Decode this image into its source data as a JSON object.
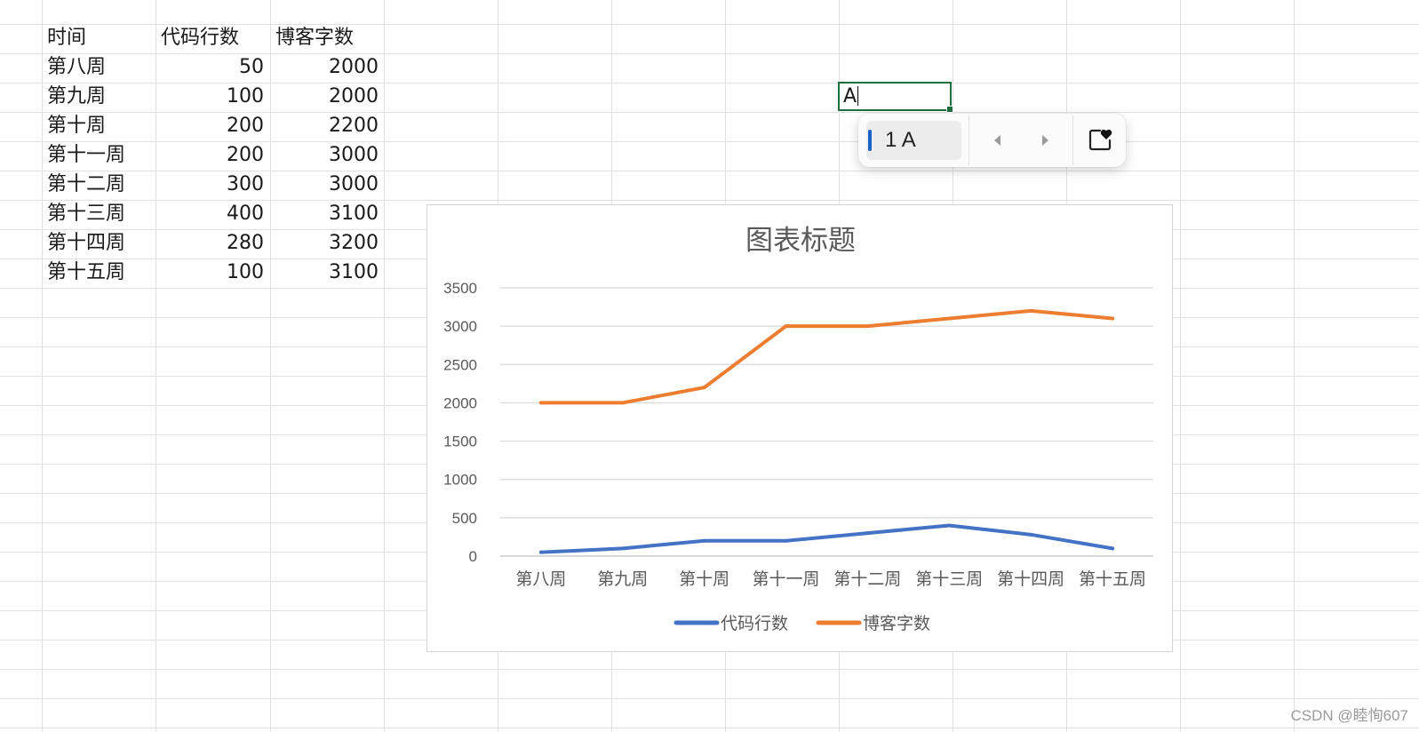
{
  "sheet": {
    "headers": [
      "时间",
      "代码行数",
      "博客字数"
    ],
    "rows": [
      [
        "第八周",
        "50",
        "2000"
      ],
      [
        "第九周",
        "100",
        "2000"
      ],
      [
        "第十周",
        "200",
        "2200"
      ],
      [
        "第十一周",
        "200",
        "3000"
      ],
      [
        "第十二周",
        "300",
        "3000"
      ],
      [
        "第十三周",
        "400",
        "3100"
      ],
      [
        "第十四周",
        "280",
        "3200"
      ],
      [
        "第十五周",
        "100",
        "3100"
      ]
    ]
  },
  "active_cell": {
    "value": "A"
  },
  "ime": {
    "candidate": "1 A",
    "prev_icon": "caret-left-icon",
    "next_icon": "caret-right-icon",
    "favorite_icon": "heart-bookmark-icon"
  },
  "chart_data": {
    "type": "line",
    "title": "图表标题",
    "categories": [
      "第八周",
      "第九周",
      "第十周",
      "第十一周",
      "第十二周",
      "第十三周",
      "第十四周",
      "第十五周"
    ],
    "series": [
      {
        "name": "代码行数",
        "values": [
          50,
          100,
          200,
          200,
          300,
          400,
          280,
          100
        ],
        "color": "#4472c4"
      },
      {
        "name": "博客字数",
        "values": [
          2000,
          2000,
          2200,
          3000,
          3000,
          3100,
          3200,
          3100
        ],
        "color": "#ed7d31"
      }
    ],
    "ylim": [
      0,
      3500
    ],
    "yticks": [
      "0",
      "500",
      "1000",
      "1500",
      "2000",
      "2500",
      "3000",
      "3500"
    ],
    "grid": true,
    "legend": "bottom"
  },
  "watermark": "CSDN @睦恂607"
}
